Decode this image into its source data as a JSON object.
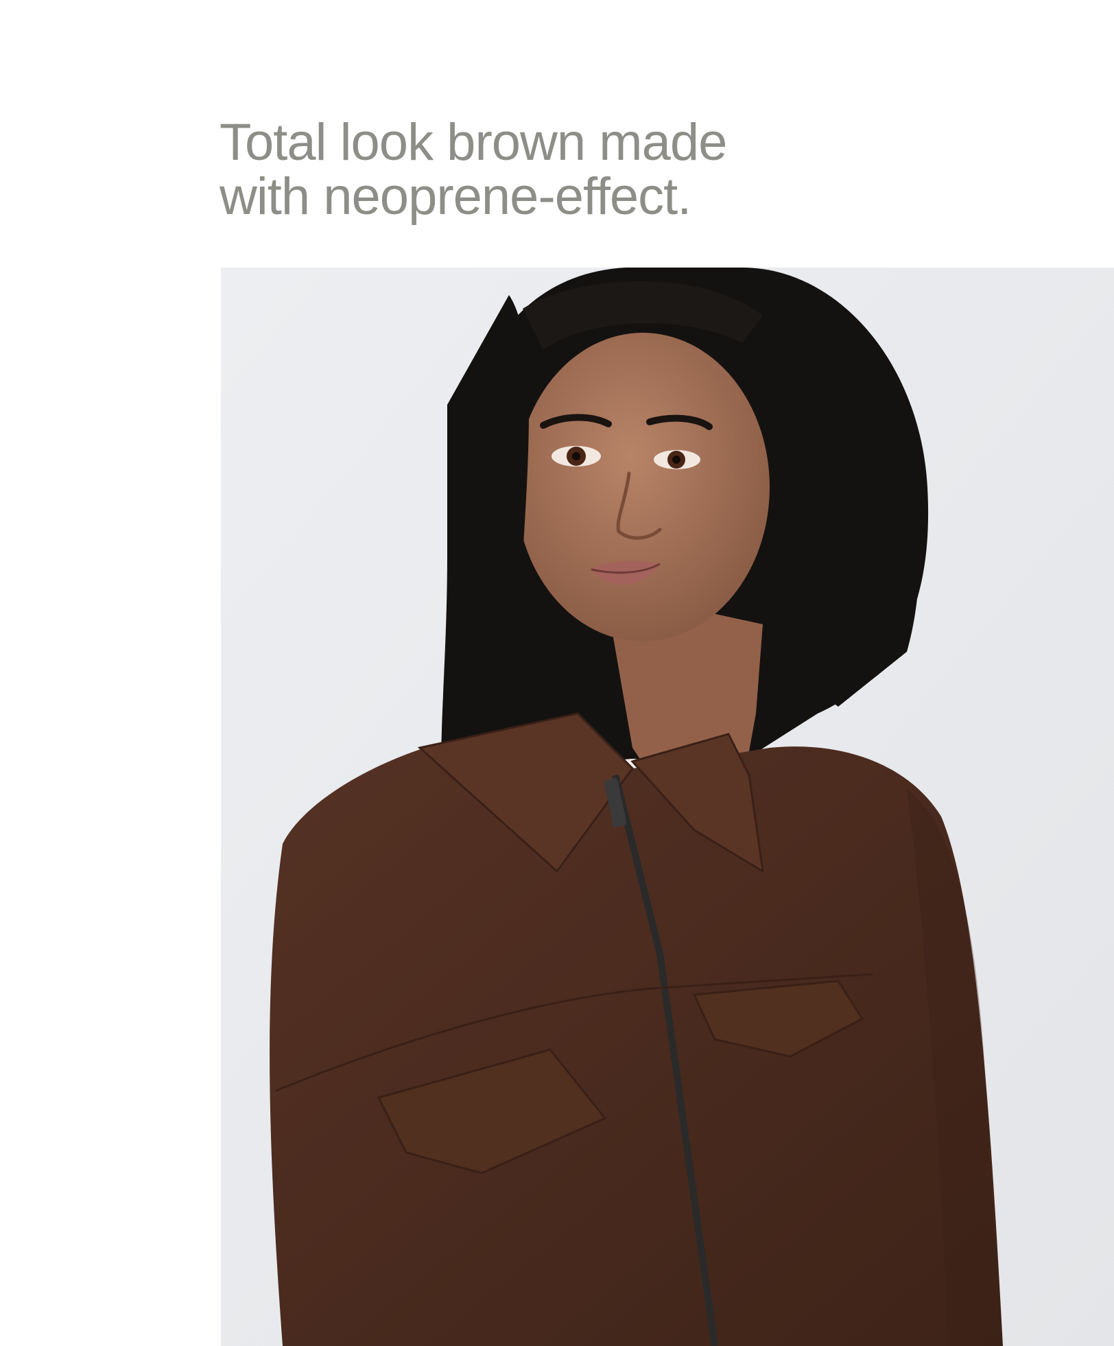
{
  "headline": {
    "line1": "Total look brown made",
    "line2": "with neoprene-effect."
  },
  "photo": {
    "subject": "model-wearing-brown-zip-jacket",
    "colors": {
      "background": "#ebecef",
      "jacket": "#4a2a1d",
      "hair": "#141210",
      "skin": "#a4735a",
      "undershirt": "#f1eee8",
      "zipper": "#2a2a2a"
    }
  }
}
